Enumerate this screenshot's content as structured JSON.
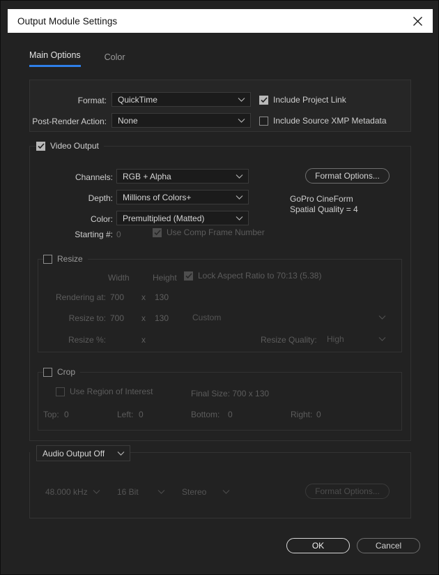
{
  "window": {
    "title": "Output Module Settings",
    "close_icon": "close-icon"
  },
  "tabs": [
    {
      "label": "Main Options",
      "active": true
    },
    {
      "label": "Color",
      "active": false
    }
  ],
  "format_section": {
    "format_label": "Format:",
    "format_value": "QuickTime",
    "post_render_label": "Post-Render Action:",
    "post_render_value": "None",
    "include_project_link": {
      "label": "Include Project Link",
      "checked": true
    },
    "include_xmp": {
      "label": "Include Source XMP Metadata",
      "checked": false
    }
  },
  "video_output": {
    "group_label": "Video Output",
    "group_checked": true,
    "channels_label": "Channels:",
    "channels_value": "RGB + Alpha",
    "depth_label": "Depth:",
    "depth_value": "Millions of Colors+",
    "color_label": "Color:",
    "color_value": "Premultiplied (Matted)",
    "starting_label": "Starting #:",
    "starting_value": "0",
    "use_comp_frame": {
      "label": "Use Comp Frame Number",
      "checked": true
    },
    "format_options_button": "Format Options...",
    "codec_name": "GoPro CineForm",
    "codec_quality": "Spatial Quality = 4"
  },
  "resize": {
    "group_label": "Resize",
    "group_checked": false,
    "width_header": "Width",
    "height_header": "Height",
    "lock_aspect": {
      "label": "Lock Aspect Ratio to 70:13 (5.38)",
      "checked": true
    },
    "rendering_at_label": "Rendering at:",
    "rendering_at_width": "700",
    "rendering_at_height": "130",
    "resize_to_label": "Resize to:",
    "resize_to_width": "700",
    "resize_to_height": "130",
    "resize_percent_label": "Resize %:",
    "resize_percent_width": "",
    "resize_percent_height": "",
    "x_symbol": "x",
    "preset_value": "Custom",
    "resize_quality_label": "Resize Quality:",
    "resize_quality_value": "High"
  },
  "crop": {
    "group_label": "Crop",
    "group_checked": false,
    "use_region_of_interest": {
      "label": "Use Region of Interest",
      "checked": false
    },
    "final_size": "Final Size: 700 x 130",
    "top_label": "Top:",
    "top_value": "0",
    "left_label": "Left:",
    "left_value": "0",
    "bottom_label": "Bottom:",
    "bottom_value": "0",
    "right_label": "Right:",
    "right_value": "0"
  },
  "audio": {
    "output_mode": "Audio Output Off",
    "sample_rate": "48.000 kHz",
    "bit_depth": "16 Bit",
    "channels": "Stereo",
    "format_options_button": "Format Options..."
  },
  "footer": {
    "ok_label": "OK",
    "cancel_label": "Cancel"
  },
  "colors": {
    "accent": "#2f7fe8",
    "title_bar_bg": "#ffffff",
    "dialog_bg": "#222222"
  }
}
